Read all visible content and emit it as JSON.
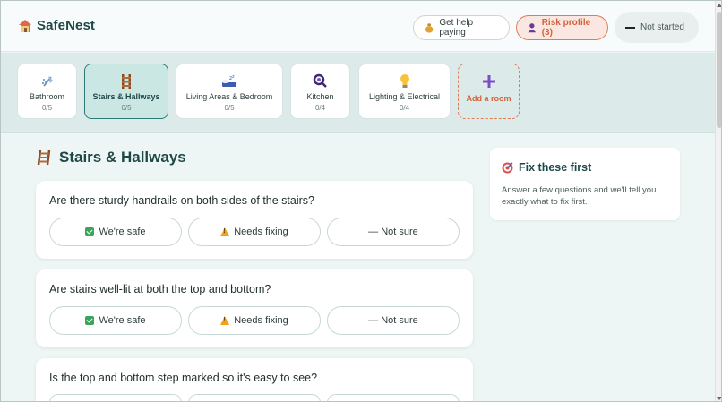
{
  "header": {
    "brand": "SafeNest",
    "help_label": "Get help paying",
    "risk_label": "Risk profile (3)",
    "status_label": "Not started"
  },
  "rooms": [
    {
      "label": "Bathroom",
      "count": "0/5",
      "icon": "shower-icon"
    },
    {
      "label": "Stairs & Hallways",
      "count": "0/5",
      "icon": "ladder-icon",
      "active": true
    },
    {
      "label": "Living Areas & Bedroom",
      "count": "0/5",
      "icon": "bed-icon"
    },
    {
      "label": "Kitchen",
      "count": "0/4",
      "icon": "magnifier-icon"
    },
    {
      "label": "Lighting & Electrical",
      "count": "0/4",
      "icon": "light-bulb-icon"
    },
    {
      "label": "Add a room",
      "icon": "plus-icon"
    }
  ],
  "section": {
    "title": "Stairs & Hallways"
  },
  "options": {
    "safe": "We're safe",
    "fix": "Needs fixing",
    "unsure": "— Not sure"
  },
  "questions": [
    "Are there sturdy handrails on both sides of the stairs?",
    "Are stairs well-lit at both the top and bottom?",
    "Is the top and bottom step marked so it's easy to see?"
  ],
  "fix_panel": {
    "title": "Fix these first",
    "body": "Answer a few questions and we'll tell you exactly what to fix first."
  },
  "colors": {
    "accent": "#2c7a78",
    "warn": "#e07b5a",
    "background": "#eef6f5"
  }
}
